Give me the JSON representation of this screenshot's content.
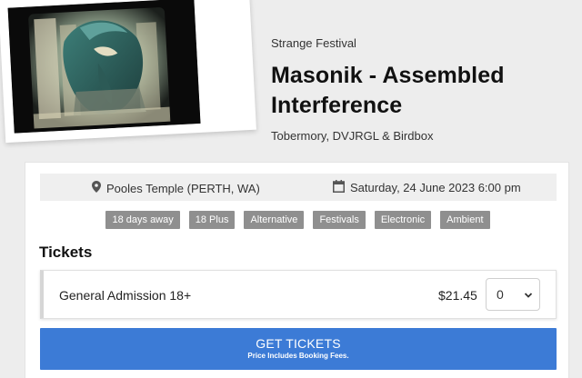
{
  "event": {
    "organiser": "Strange Festival",
    "title": "Masonik - Assembled Interference",
    "artists": "Tobermory, DVJRGL & Birdbox",
    "poster_icon": "poster-image"
  },
  "info": {
    "venue": "Pooles Temple (PERTH, WA)",
    "venue_icon": "map-pin-icon",
    "datetime": "Saturday, 24 June 2023 6:00 pm",
    "datetime_icon": "calendar-icon"
  },
  "tags": [
    "18 days away",
    "18 Plus",
    "Alternative",
    "Festivals",
    "Electronic",
    "Ambient"
  ],
  "tickets": {
    "heading": "Tickets",
    "items": [
      {
        "name": "General Admission 18+",
        "price": "$21.45",
        "quantity": "0"
      }
    ]
  },
  "cta": {
    "label": "GET TICKETS",
    "sublabel": "Price Includes Booking Fees."
  },
  "colors": {
    "page_bg": "#ededed",
    "button": "#3c7bd6",
    "tag_bg": "#8f8f8f"
  }
}
